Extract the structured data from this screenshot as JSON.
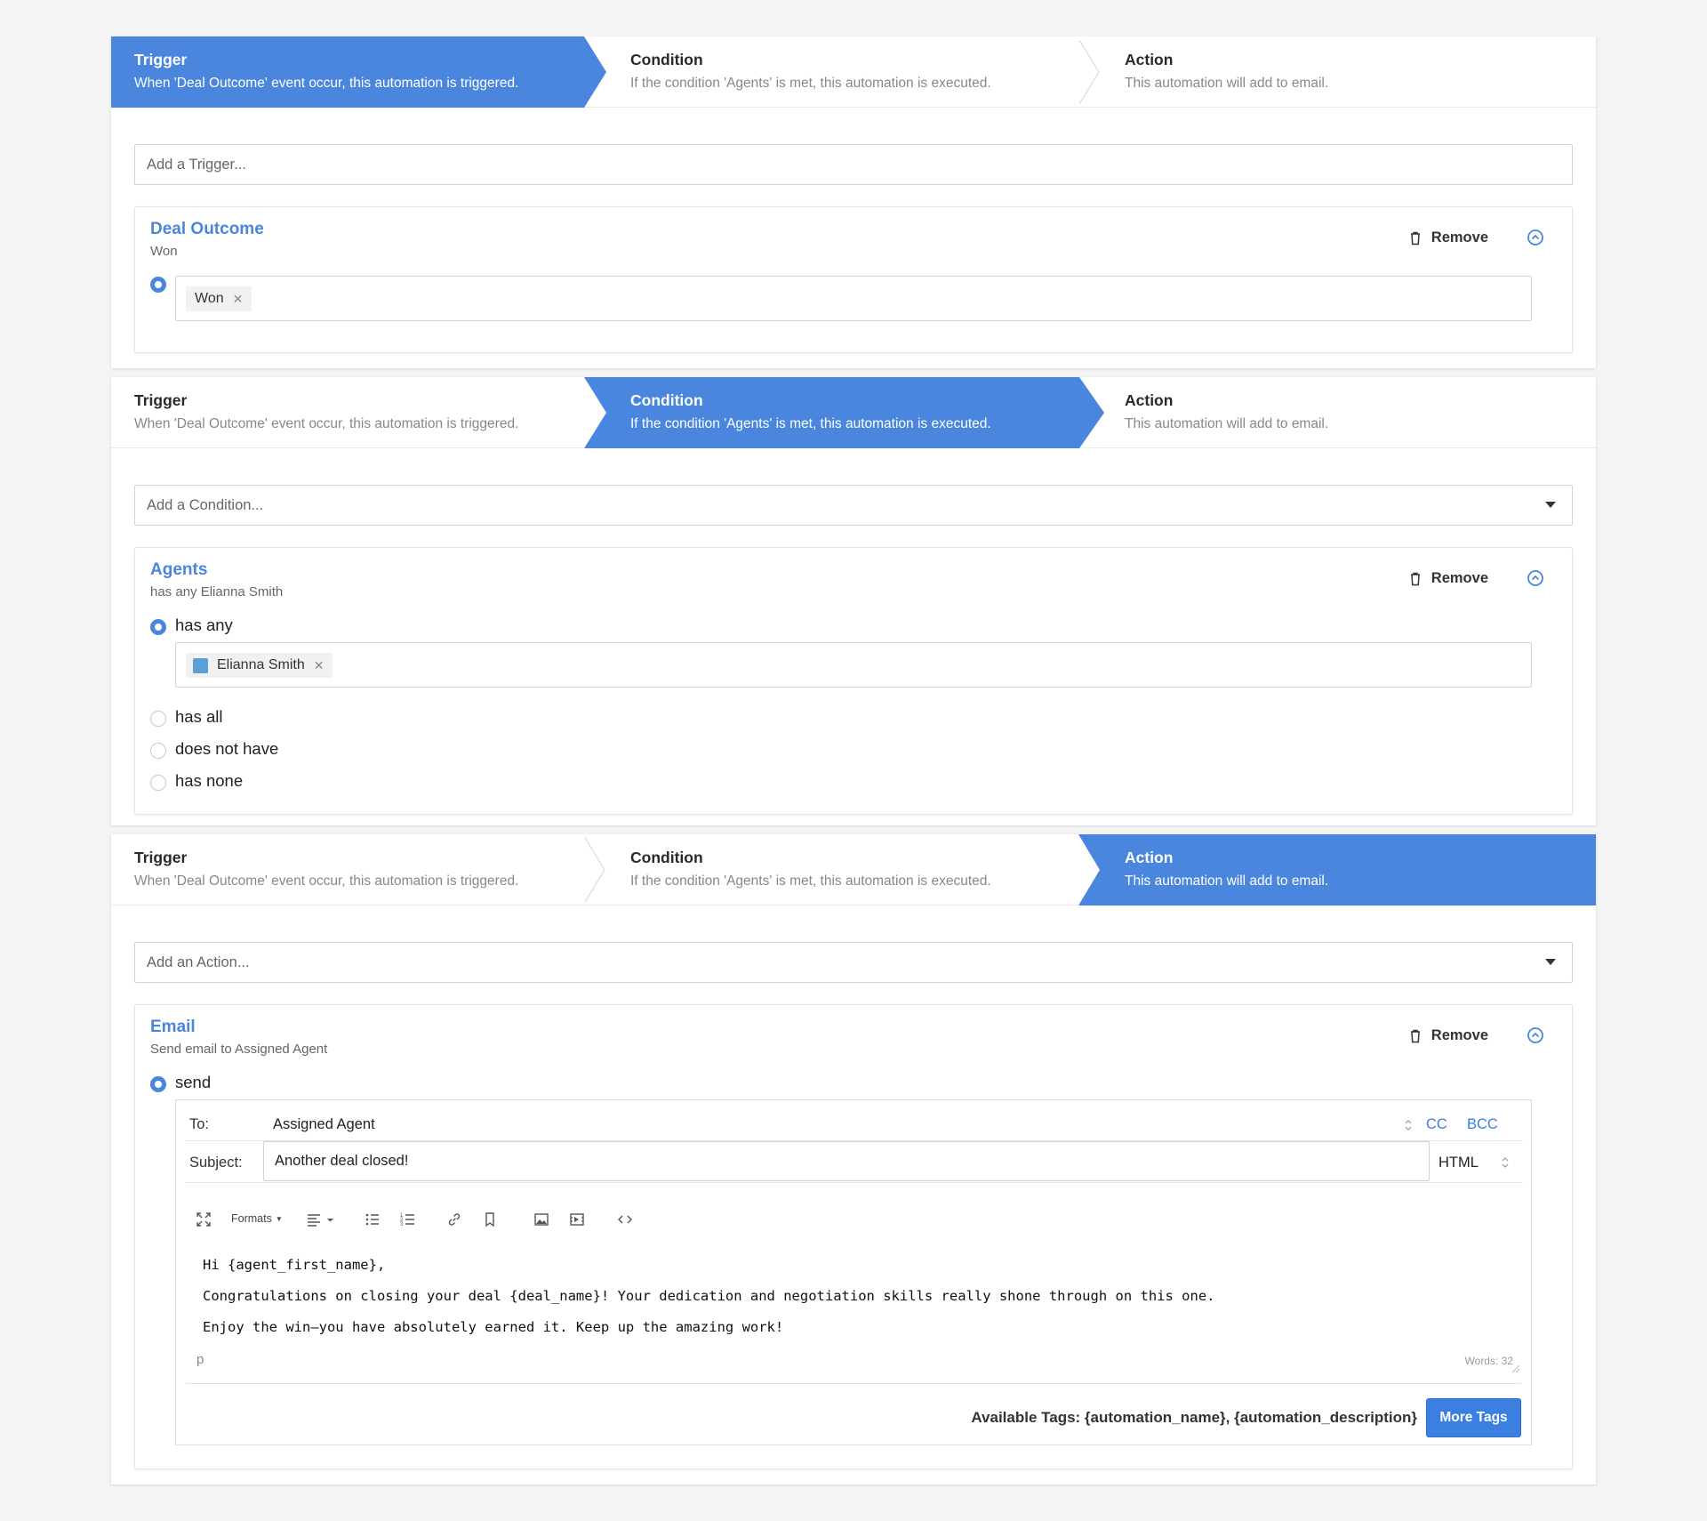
{
  "steps": {
    "trigger": {
      "title": "Trigger",
      "desc": "When 'Deal Outcome' event occur, this automation is triggered."
    },
    "condition": {
      "title": "Condition",
      "desc": "If the condition 'Agents' is met, this automation is executed."
    },
    "action": {
      "title": "Action",
      "desc": "This automation will add to email."
    }
  },
  "colors": {
    "accent": "#4a86dd",
    "button": "#3b7fe0"
  },
  "trigger_panel": {
    "input_placeholder": "Add a Trigger...",
    "card": {
      "title": "Deal Outcome",
      "subtitle": "Won",
      "remove_label": "Remove",
      "tag": "Won"
    }
  },
  "condition_panel": {
    "input_placeholder": "Add a Condition...",
    "card": {
      "title": "Agents",
      "subtitle": "has any Elianna Smith",
      "remove_label": "Remove",
      "options": [
        "has any",
        "has all",
        "does not have",
        "has none"
      ],
      "selected": "has any",
      "tag": "Elianna Smith"
    }
  },
  "action_panel": {
    "input_placeholder": "Add an Action...",
    "card": {
      "title": "Email",
      "subtitle": "Send email to Assigned Agent",
      "remove_label": "Remove",
      "option": "send",
      "to_label": "To:",
      "to_value": "Assigned Agent",
      "cc": "CC",
      "bcc": "BCC",
      "subject_label": "Subject:",
      "subject_value": "Another deal closed!",
      "format": "HTML",
      "toolbar_formats": "Formats",
      "body": [
        "Hi {agent_first_name},",
        "Congratulations on closing your deal {deal_name}! Your dedication and negotiation skills really shone through on this one.",
        "Enjoy the win—you have absolutely earned it. Keep up the amazing work!"
      ],
      "path": "p",
      "word_count": "Words: 32",
      "available_tags": "Available Tags: {automation_name}, {automation_description}",
      "more_tags": "More Tags"
    }
  }
}
